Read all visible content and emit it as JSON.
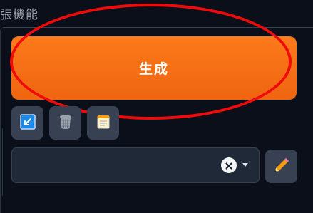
{
  "section": {
    "title": "張機能"
  },
  "generate_button": {
    "label": "生成",
    "color": "#f97316"
  },
  "highlight": {
    "color": "#ef0b0b"
  },
  "tool_buttons": [
    {
      "name": "apply-icon"
    },
    {
      "name": "trash-icon"
    },
    {
      "name": "notepad-icon"
    }
  ],
  "dropdown": {
    "value": ""
  },
  "edit_button": {
    "icon": "pencil-icon"
  }
}
